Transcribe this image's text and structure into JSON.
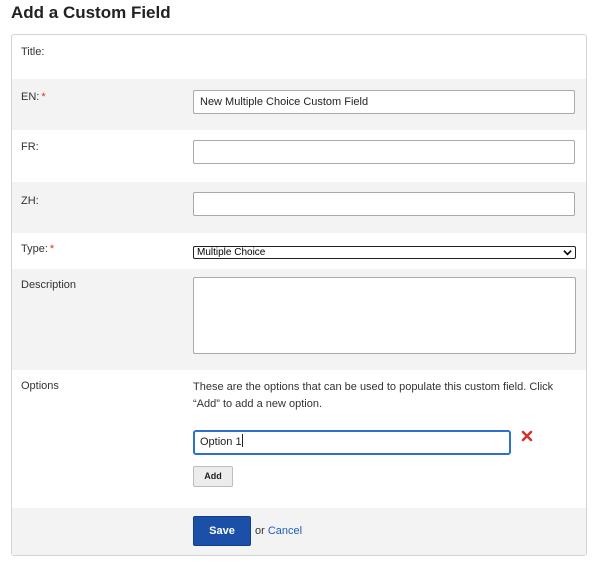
{
  "page": {
    "title": "Add a Custom Field"
  },
  "form": {
    "title_label": "Title:",
    "en_label": "EN:",
    "en_value": "New Multiple Choice Custom Field",
    "fr_label": "FR:",
    "fr_value": "",
    "zh_label": "ZH:",
    "zh_value": "",
    "required_marker": "*",
    "type_label": "Type:",
    "type_value": "Multiple Choice",
    "description_label": "Description",
    "description_value": "",
    "options_label": "Options",
    "options_help": "These are the options that can be used to populate this custom field. Click “Add” to add a new option.",
    "options": [
      {
        "value": "Option 1"
      }
    ],
    "add_label": "Add",
    "save_label": "Save",
    "or_text": "or",
    "cancel_label": "Cancel"
  },
  "icons": {
    "remove": "remove-x-icon",
    "select": "chevron-down-icon",
    "resize": "resize-grip-icon"
  },
  "colors": {
    "required": "#d0342c",
    "primary": "#1c50a8",
    "link": "#1d5fb8",
    "focus": "#2f6fce",
    "row_shade": "#f3f3f3"
  }
}
